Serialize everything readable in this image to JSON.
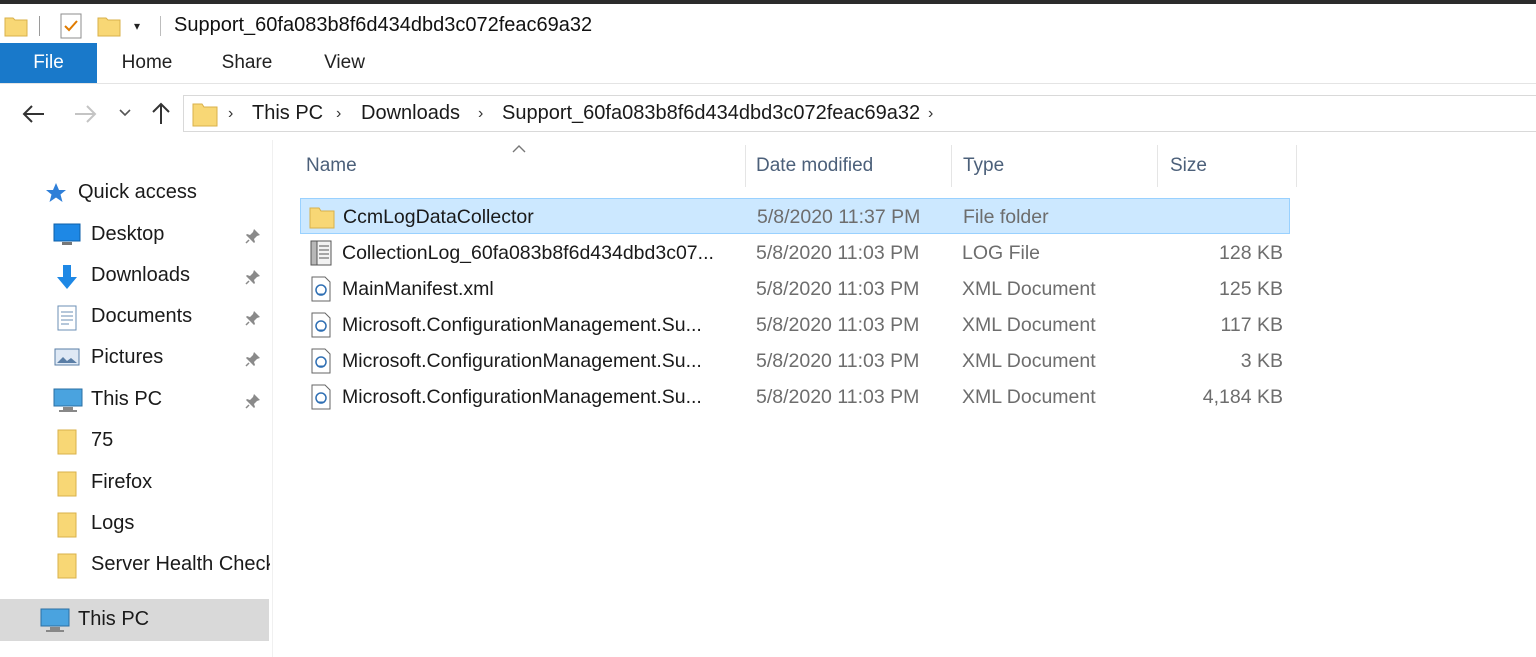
{
  "window": {
    "title": "Support_60fa083b8f6d434dbd3c072feac69a32",
    "qa_dropdown": "▾"
  },
  "ribbon": {
    "tabs": [
      {
        "label": "File"
      },
      {
        "label": "Home"
      },
      {
        "label": "Share"
      },
      {
        "label": "View"
      }
    ]
  },
  "address": {
    "separator": "›",
    "crumbs": [
      {
        "label": "This PC"
      },
      {
        "label": "Downloads"
      },
      {
        "label": "Support_60fa083b8f6d434dbd3c072feac69a32"
      }
    ]
  },
  "navpane": {
    "quick_access": "Quick access",
    "items": [
      {
        "label": "Desktop",
        "icon": "desktop-icon",
        "pinned": true
      },
      {
        "label": "Downloads",
        "icon": "downloads-icon",
        "pinned": true
      },
      {
        "label": "Documents",
        "icon": "documents-icon",
        "pinned": true
      },
      {
        "label": "Pictures",
        "icon": "pictures-icon",
        "pinned": true
      },
      {
        "label": "This PC",
        "icon": "this-pc-icon",
        "pinned": true
      },
      {
        "label": "75",
        "icon": "folder-icon",
        "pinned": false
      },
      {
        "label": "Firefox",
        "icon": "folder-icon",
        "pinned": false
      },
      {
        "label": "Logs",
        "icon": "folder-icon",
        "pinned": false
      },
      {
        "label": "Server Health Check",
        "icon": "folder-icon",
        "pinned": false
      }
    ],
    "this_pc": "This PC"
  },
  "filelist": {
    "columns": {
      "name": "Name",
      "date": "Date modified",
      "type": "Type",
      "size": "Size"
    },
    "rows": [
      {
        "name": "CcmLogDataCollector",
        "date": "5/8/2020 11:37 PM",
        "type": "File folder",
        "size": "",
        "icon": "folder-icon",
        "selected": true
      },
      {
        "name": "CollectionLog_60fa083b8f6d434dbd3c07...",
        "date": "5/8/2020 11:03 PM",
        "type": "LOG File",
        "size": "128 KB",
        "icon": "log-file-icon",
        "selected": false
      },
      {
        "name": "MainManifest.xml",
        "date": "5/8/2020 11:03 PM",
        "type": "XML Document",
        "size": "125 KB",
        "icon": "xml-file-icon",
        "selected": false
      },
      {
        "name": "Microsoft.ConfigurationManagement.Su...",
        "date": "5/8/2020 11:03 PM",
        "type": "XML Document",
        "size": "117 KB",
        "icon": "xml-file-icon",
        "selected": false
      },
      {
        "name": "Microsoft.ConfigurationManagement.Su...",
        "date": "5/8/2020 11:03 PM",
        "type": "XML Document",
        "size": "3 KB",
        "icon": "xml-file-icon",
        "selected": false
      },
      {
        "name": "Microsoft.ConfigurationManagement.Su...",
        "date": "5/8/2020 11:03 PM",
        "type": "XML Document",
        "size": "4,184 KB",
        "icon": "xml-file-icon",
        "selected": false
      }
    ]
  },
  "colors": {
    "accent": "#1979ca",
    "selection_bg": "#cce8ff",
    "selection_border": "#99d1ff",
    "folder": "#f8d775"
  }
}
